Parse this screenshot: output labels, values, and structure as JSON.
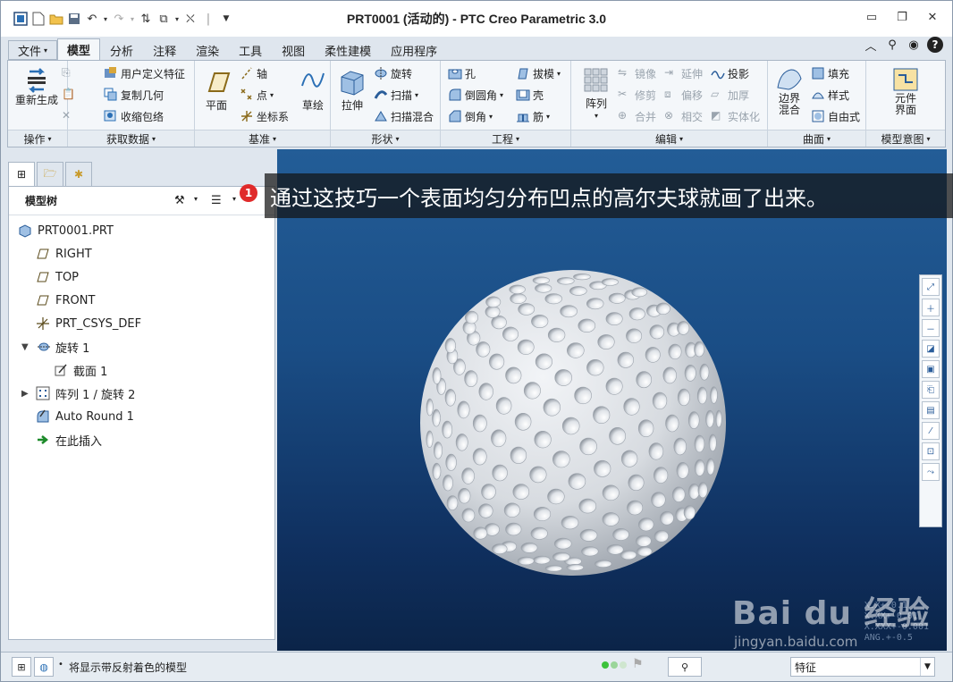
{
  "window": {
    "title": "PRT0001 (活动的) - PTC Creo Parametric 3.0"
  },
  "tabs": [
    {
      "label": "文件"
    },
    {
      "label": "模型"
    },
    {
      "label": "分析"
    },
    {
      "label": "注释"
    },
    {
      "label": "渲染"
    },
    {
      "label": "工具"
    },
    {
      "label": "视图"
    },
    {
      "label": "柔性建模"
    },
    {
      "label": "应用程序"
    }
  ],
  "ribbon": {
    "operations": {
      "label": "操作",
      "regenerate": "重新生成"
    },
    "get_data": {
      "label": "获取数据",
      "udf": "用户定义特征",
      "copy_geom": "复制几何",
      "shrinkwrap": "收缩包络"
    },
    "datum": {
      "label": "基准",
      "plane": "平面",
      "axis": "轴",
      "point": "点",
      "csys": "坐标系",
      "sketch": "草绘"
    },
    "shapes": {
      "label": "形状",
      "extrude": "拉伸",
      "revolve": "旋转",
      "sweep": "扫描",
      "swept_blend": "扫描混合"
    },
    "engineering": {
      "label": "工程",
      "hole": "孔",
      "round": "倒圆角",
      "chamfer": "倒角",
      "draft": "拔模",
      "shell": "壳",
      "rib": "筋"
    },
    "editing": {
      "label": "编辑",
      "pattern": "阵列",
      "mirror": "镜像",
      "trim": "修剪",
      "merge": "合并",
      "extend": "延伸",
      "offset": "偏移",
      "intersect": "相交",
      "project": "投影",
      "thicken": "加厚",
      "solidify": "实体化"
    },
    "surfaces": {
      "label": "曲面",
      "boundary_blend": "边界混合",
      "fill": "填充",
      "style": "样式",
      "freestyle": "自由式"
    },
    "model_intent": {
      "label": "模型意图",
      "component_interface": "元件界面"
    }
  },
  "tree": {
    "title": "模型树",
    "items": [
      {
        "label": "PRT0001.PRT"
      },
      {
        "label": "RIGHT"
      },
      {
        "label": "TOP"
      },
      {
        "label": "FRONT"
      },
      {
        "label": "PRT_CSYS_DEF"
      },
      {
        "label": "旋转 1"
      },
      {
        "label": "截面 1"
      },
      {
        "label": "阵列 1 / 旋转 2"
      },
      {
        "label": "Auto Round 1"
      },
      {
        "label": "在此插入"
      }
    ]
  },
  "annotation": {
    "badge": "1",
    "caption": "通过这技巧一个表面均匀分布凹点的高尔夫球就画了出来。"
  },
  "viewport": {
    "tolerance_lines": [
      "X.X+-0.1",
      "X.XX+-0.01",
      "X.XXX+-0.001",
      "ANG.+-0.5"
    ]
  },
  "watermark": {
    "brand": "Bai du 经验",
    "url": "jingyan.baidu.com"
  },
  "status": {
    "message": "将显示带反射着色的模型",
    "filter": "特征"
  }
}
